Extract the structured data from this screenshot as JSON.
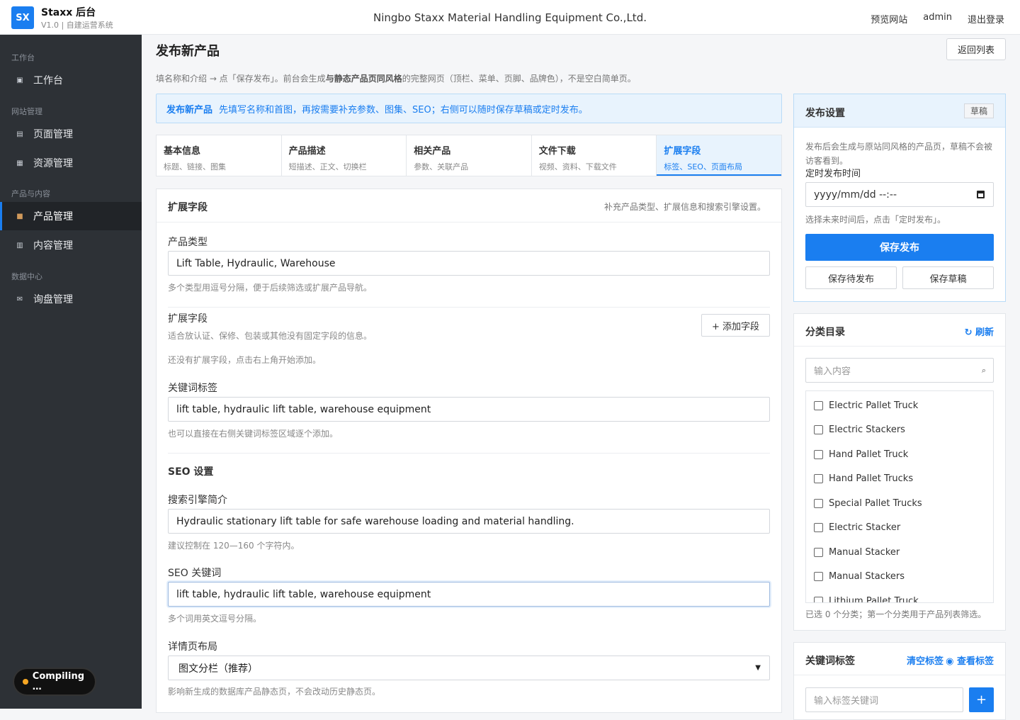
{
  "app": {
    "logo_text": "SX",
    "title": "Staxx 后台",
    "subtitle": "V1.0 | 自建运营系统",
    "company": "Ningbo Staxx Material Handling Equipment Co.,Ltd."
  },
  "top_links": {
    "preview": "预览网站",
    "user": "admin",
    "logout": "退出登录"
  },
  "sidebar": {
    "groups": [
      "工作台",
      "网站管理",
      "产品与内容",
      "数据中心"
    ],
    "items": [
      {
        "label": "工作台",
        "icon": "dashboard-icon"
      },
      {
        "label": "页面管理",
        "icon": "page-icon"
      },
      {
        "label": "资源管理",
        "icon": "image-icon"
      },
      {
        "label": "产品管理",
        "icon": "box-icon"
      },
      {
        "label": "内容管理",
        "icon": "content-icon"
      },
      {
        "label": "询盘管理",
        "icon": "mail-icon"
      }
    ]
  },
  "compiling": "Compiling …",
  "page": {
    "title": "发布新产品",
    "back": "返回列表",
    "intro_a": "填名称和介绍 → 点「保存发布」。前台会生成",
    "intro_b": "与静态产品页同风格",
    "intro_c": "的完整网页（顶栏、菜单、页脚、品牌色），不是空白简单页。",
    "notice_title": "发布新产品",
    "notice_text": "先填写名称和首图，再按需要补充参数、图集、SEO；右侧可以随时保存草稿或定时发布。"
  },
  "tabs": [
    {
      "title": "基本信息",
      "sub": "标题、链接、图集"
    },
    {
      "title": "产品描述",
      "sub": "短描述、正文、切换栏"
    },
    {
      "title": "相关产品",
      "sub": "参数、关联产品"
    },
    {
      "title": "文件下载",
      "sub": "视频、资料、下载文件"
    },
    {
      "title": "扩展字段",
      "sub": "标签、SEO、页面布局"
    }
  ],
  "form": {
    "heading": "扩展字段",
    "heading_hint": "补充产品类型、扩展信息和搜索引擎设置。",
    "type_label": "产品类型",
    "type_value": "Lift Table, Hydraulic, Warehouse",
    "type_help": "多个类型用逗号分隔，便于后续筛选或扩展产品导航。",
    "ext_label": "扩展字段",
    "ext_help": "适合放认证、保修、包装或其他没有固定字段的信息。",
    "ext_add": "+ 添加字段",
    "ext_empty": "还没有扩展字段，点击右上角开始添加。",
    "kw_label": "关键词标签",
    "kw_value": "lift table, hydraulic lift table, warehouse equipment",
    "kw_help": "也可以直接在右侧关键词标签区域逐个添加。",
    "seo_title": "SEO 设置",
    "seo_desc_label": "搜索引擎简介",
    "seo_desc_value": "Hydraulic stationary lift table for safe warehouse loading and material handling.",
    "seo_desc_help": "建议控制在 120—160 个字符内。",
    "seo_kw_label": "SEO 关键词",
    "seo_kw_value": "lift table, hydraulic lift table, warehouse equipment",
    "seo_kw_help": "多个词用英文逗号分隔。",
    "layout_label": "详情页布局",
    "layout_value": "图文分栏（推荐）",
    "layout_help": "影响新生成的数据库产品静态页，不会改动历史静态页。"
  },
  "publish": {
    "title": "发布设置",
    "badge": "草稿",
    "text": "发布后会生成与原站同风格的产品页，草稿不会被访客看到。",
    "time_label": "定时发布时间",
    "time_value": "yyyy/mm/dd --:--",
    "time_help": "选择未来时间后，点击「定时发布」。",
    "primary": "保存发布",
    "pending": "保存待发布",
    "draft": "保存草稿"
  },
  "category": {
    "title": "分类目录",
    "refresh": "↻ 刷新",
    "placeholder": "输入内容",
    "items": [
      "Electric Pallet Truck",
      "Electric Stackers",
      "Hand Pallet Truck",
      "Hand Pallet Trucks",
      "Special Pallet Trucks",
      "Electric Stacker",
      "Manual Stacker",
      "Manual Stackers",
      "Lithium Pallet Truck"
    ],
    "footer": "已选 0 个分类；第一个分类用于产品列表筛选。"
  },
  "keywords": {
    "title": "关键词标签",
    "clear": "清空标签",
    "view": "◉ 查看标签",
    "placeholder": "输入标签关键词",
    "add": "+"
  },
  "colors": {
    "accent": "#1a7ef0",
    "sidebar": "#2d3136"
  }
}
